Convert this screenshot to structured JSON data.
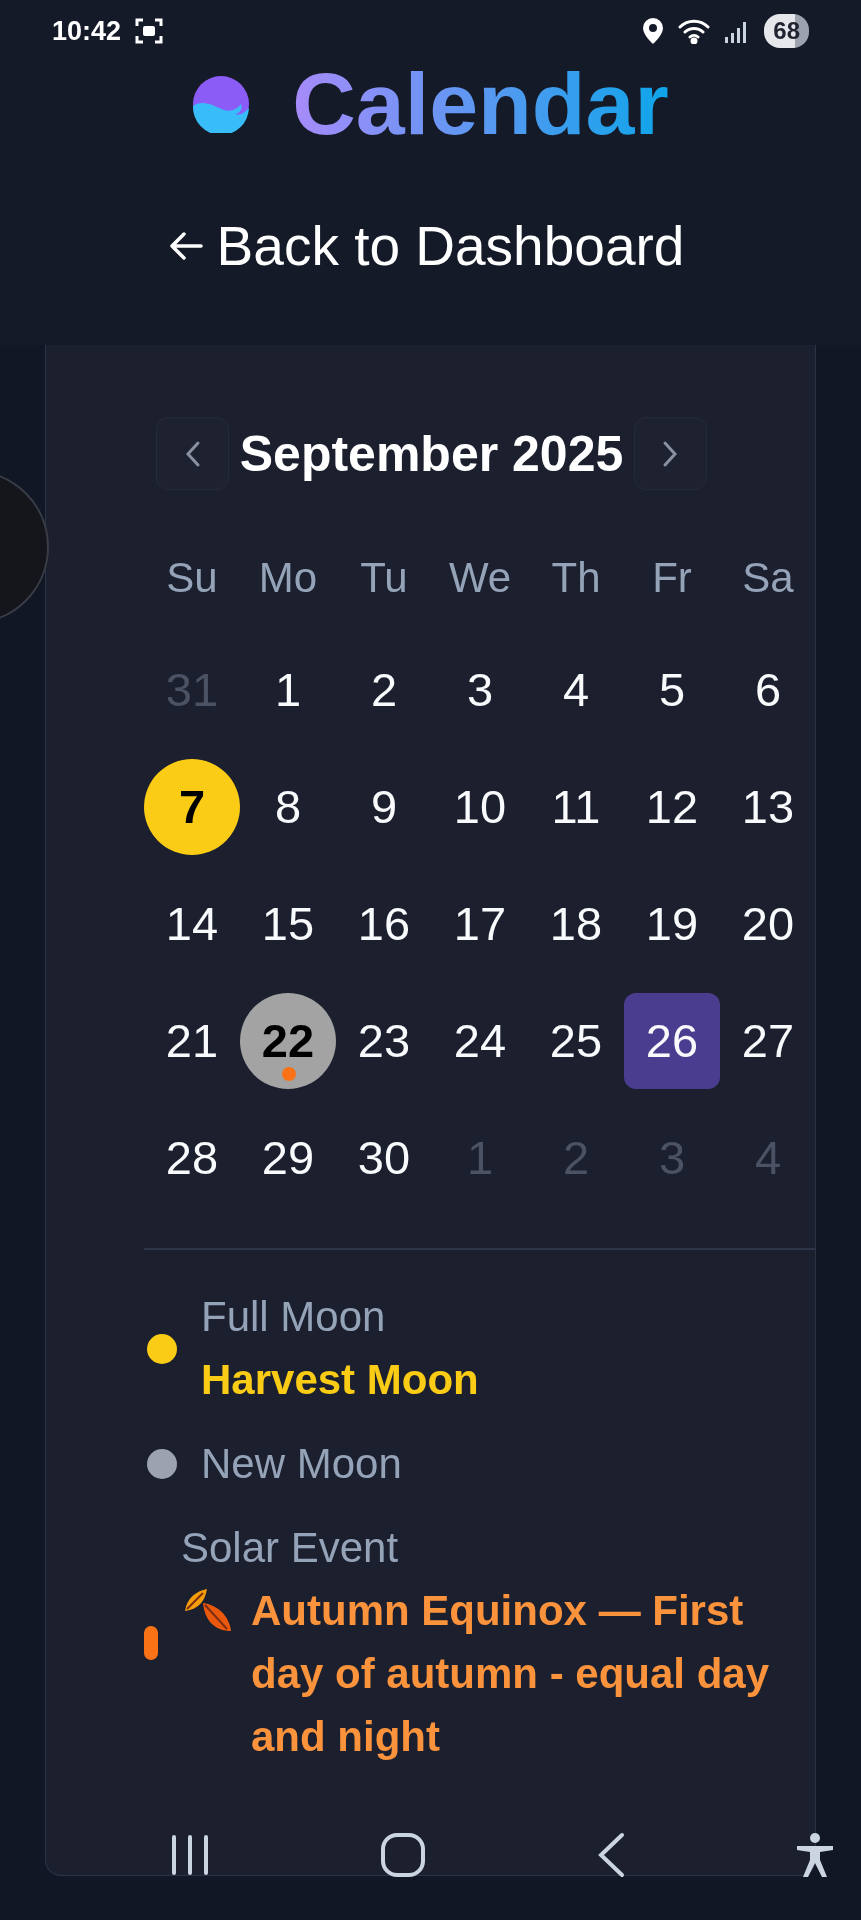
{
  "status_bar": {
    "time": "10:42",
    "battery": "68"
  },
  "header": {
    "title": "Calendar",
    "back_link": "Back to Dashboard"
  },
  "calendar": {
    "month": "September 2025",
    "weekdays": [
      "Su",
      "Mo",
      "Tu",
      "We",
      "Th",
      "Fr",
      "Sa"
    ],
    "weeks": [
      [
        {
          "day": "31",
          "outside_month": true,
          "selected": false,
          "full_moon": false,
          "new_moon": false,
          "solar": false
        },
        {
          "day": "1",
          "outside_month": false,
          "selected": false,
          "full_moon": false,
          "new_moon": false,
          "solar": false
        },
        {
          "day": "2",
          "outside_month": false,
          "selected": false,
          "full_moon": false,
          "new_moon": false,
          "solar": false
        },
        {
          "day": "3",
          "outside_month": false,
          "selected": false,
          "full_moon": false,
          "new_moon": false,
          "solar": false
        },
        {
          "day": "4",
          "outside_month": false,
          "selected": false,
          "full_moon": false,
          "new_moon": false,
          "solar": false
        },
        {
          "day": "5",
          "outside_month": false,
          "selected": false,
          "full_moon": false,
          "new_moon": false,
          "solar": false
        },
        {
          "day": "6",
          "outside_month": false,
          "selected": false,
          "full_moon": false,
          "new_moon": false,
          "solar": false
        }
      ],
      [
        {
          "day": "7",
          "outside_month": false,
          "selected": false,
          "full_moon": true,
          "new_moon": false,
          "solar": false
        },
        {
          "day": "8",
          "outside_month": false,
          "selected": false,
          "full_moon": false,
          "new_moon": false,
          "solar": false
        },
        {
          "day": "9",
          "outside_month": false,
          "selected": false,
          "full_moon": false,
          "new_moon": false,
          "solar": false
        },
        {
          "day": "10",
          "outside_month": false,
          "selected": false,
          "full_moon": false,
          "new_moon": false,
          "solar": false
        },
        {
          "day": "11",
          "outside_month": false,
          "selected": false,
          "full_moon": false,
          "new_moon": false,
          "solar": false
        },
        {
          "day": "12",
          "outside_month": false,
          "selected": false,
          "full_moon": false,
          "new_moon": false,
          "solar": false
        },
        {
          "day": "13",
          "outside_month": false,
          "selected": false,
          "full_moon": false,
          "new_moon": false,
          "solar": false
        }
      ],
      [
        {
          "day": "14",
          "outside_month": false,
          "selected": false,
          "full_moon": false,
          "new_moon": false,
          "solar": false
        },
        {
          "day": "15",
          "outside_month": false,
          "selected": false,
          "full_moon": false,
          "new_moon": false,
          "solar": false
        },
        {
          "day": "16",
          "outside_month": false,
          "selected": false,
          "full_moon": false,
          "new_moon": false,
          "solar": false
        },
        {
          "day": "17",
          "outside_month": false,
          "selected": false,
          "full_moon": false,
          "new_moon": false,
          "solar": false
        },
        {
          "day": "18",
          "outside_month": false,
          "selected": false,
          "full_moon": false,
          "new_moon": false,
          "solar": false
        },
        {
          "day": "19",
          "outside_month": false,
          "selected": false,
          "full_moon": false,
          "new_moon": false,
          "solar": false
        },
        {
          "day": "20",
          "outside_month": false,
          "selected": false,
          "full_moon": false,
          "new_moon": false,
          "solar": false
        }
      ],
      [
        {
          "day": "21",
          "outside_month": false,
          "selected": false,
          "full_moon": false,
          "new_moon": false,
          "solar": false
        },
        {
          "day": "22",
          "outside_month": false,
          "selected": false,
          "full_moon": false,
          "new_moon": true,
          "solar": true
        },
        {
          "day": "23",
          "outside_month": false,
          "selected": false,
          "full_moon": false,
          "new_moon": false,
          "solar": false
        },
        {
          "day": "24",
          "outside_month": false,
          "selected": false,
          "full_moon": false,
          "new_moon": false,
          "solar": false
        },
        {
          "day": "25",
          "outside_month": false,
          "selected": false,
          "full_moon": false,
          "new_moon": false,
          "solar": false
        },
        {
          "day": "26",
          "outside_month": false,
          "selected": true,
          "full_moon": false,
          "new_moon": false,
          "solar": false
        },
        {
          "day": "27",
          "outside_month": false,
          "selected": false,
          "full_moon": false,
          "new_moon": false,
          "solar": false
        }
      ],
      [
        {
          "day": "28",
          "outside_month": false,
          "selected": false,
          "full_moon": false,
          "new_moon": false,
          "solar": false
        },
        {
          "day": "29",
          "outside_month": false,
          "selected": false,
          "full_moon": false,
          "new_moon": false,
          "solar": false
        },
        {
          "day": "30",
          "outside_month": false,
          "selected": false,
          "full_moon": false,
          "new_moon": false,
          "solar": false
        },
        {
          "day": "1",
          "outside_month": true,
          "selected": false,
          "full_moon": false,
          "new_moon": false,
          "solar": false
        },
        {
          "day": "2",
          "outside_month": true,
          "selected": false,
          "full_moon": false,
          "new_moon": false,
          "solar": false
        },
        {
          "day": "3",
          "outside_month": true,
          "selected": false,
          "full_moon": false,
          "new_moon": false,
          "solar": false
        },
        {
          "day": "4",
          "outside_month": true,
          "selected": false,
          "full_moon": false,
          "new_moon": false,
          "solar": false
        }
      ]
    ]
  },
  "legend": [
    {
      "kind": "moon",
      "color": "#facc15",
      "label": "Full Moon",
      "detail": "Harvest Moon"
    },
    {
      "kind": "moon",
      "color": "#9ca3af",
      "label": "New Moon"
    },
    {
      "kind": "solar",
      "color": "#f97316",
      "label": "Solar Event",
      "detail": "Autumn Equinox — First day of autumn - equal day and night"
    }
  ]
}
